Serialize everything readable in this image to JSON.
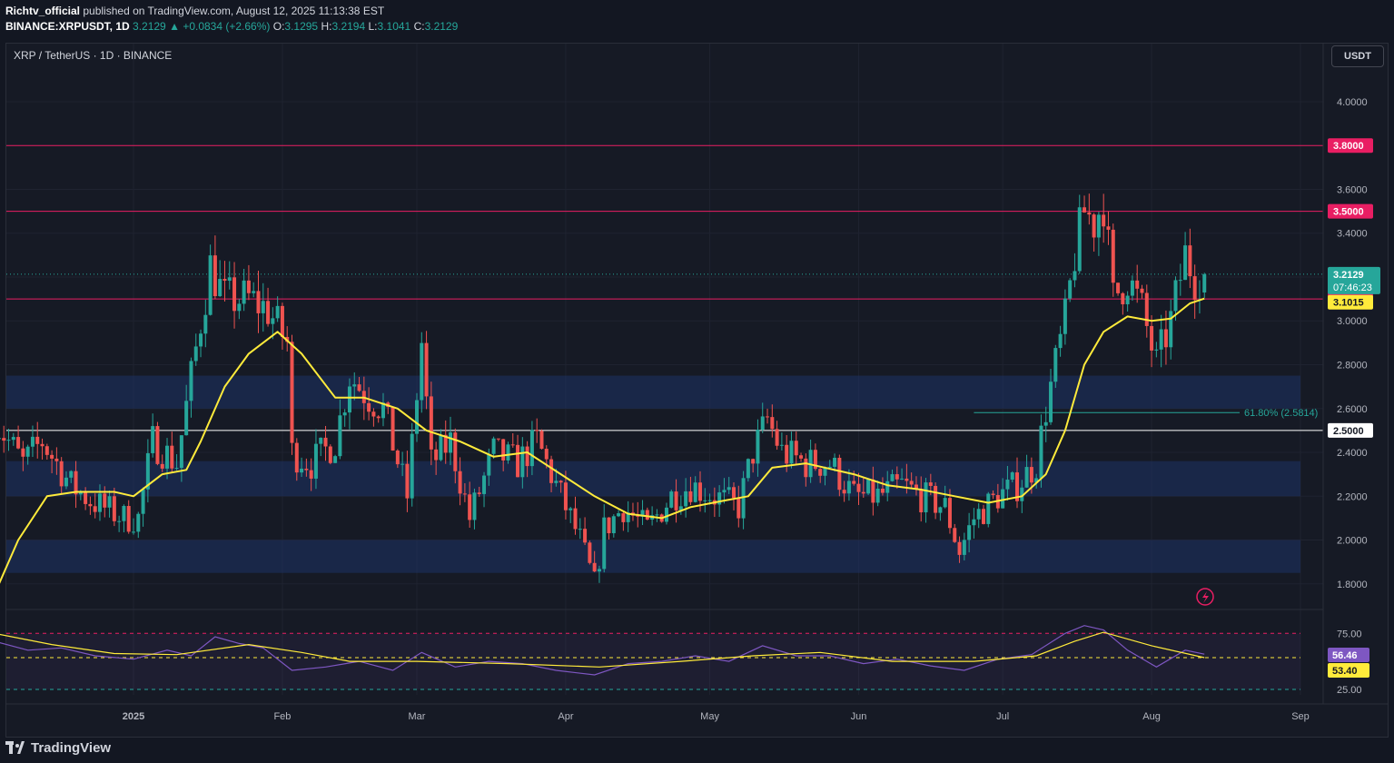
{
  "header": {
    "author": "Richtv_official",
    "published_text": " published on TradingView.com, August 12, 2025 11:13:38 EST",
    "symbol": "BINANCE:XRPUSDT, 1D",
    "last": "3.2129",
    "change": "+0.0834 (+2.66%)",
    "open_label": "O:",
    "open": "3.1295",
    "high_label": "H:",
    "high": "3.2194",
    "low_label": "L:",
    "low": "3.1041",
    "close_label": "C:",
    "close": "3.2129"
  },
  "chart_title": "XRP / TetherUS · 1D · BINANCE",
  "currency_button": "USDT",
  "footer_brand": "TradingView",
  "colors": {
    "background": "#161a25",
    "up": "#26a69a",
    "down": "#ef5350",
    "ma": "#ffeb3b",
    "level_line": "#e91e63",
    "zone": "#1e3366",
    "rsi": "#7e57c2",
    "grid": "#1f2330"
  },
  "chart_data": {
    "type": "candlestick",
    "symbol": "XRPUSDT",
    "timeframe": "1D",
    "start_date": "2024-12-03",
    "y_axis": {
      "ticks": [
        1.8,
        2.0,
        2.2,
        2.4,
        2.6,
        2.8,
        3.0,
        3.2,
        3.4,
        3.6,
        4.0
      ],
      "ylim": [
        1.7,
        4.2
      ]
    },
    "x_axis": {
      "labels": [
        "2025",
        "Feb",
        "Mar",
        "Apr",
        "May",
        "Jun",
        "Jul",
        "Aug",
        "Sep"
      ],
      "label_dates": [
        "2025-01-01",
        "2025-02-01",
        "2025-03-01",
        "2025-04-01",
        "2025-05-01",
        "2025-06-01",
        "2025-07-01",
        "2025-08-01",
        "2025-09-01"
      ]
    },
    "close_path": [
      [
        "2024-12-03",
        2.55
      ],
      [
        "2024-12-09",
        2.35
      ],
      [
        "2024-12-13",
        2.45
      ],
      [
        "2024-12-19",
        2.25
      ],
      [
        "2024-12-23",
        2.18
      ],
      [
        "2024-12-30",
        2.1
      ],
      [
        "2025-01-02",
        2.1
      ],
      [
        "2025-01-05",
        2.45
      ],
      [
        "2025-01-10",
        2.35
      ],
      [
        "2025-01-15",
        3.0
      ],
      [
        "2025-01-17",
        3.25
      ],
      [
        "2025-01-20",
        3.1
      ],
      [
        "2025-01-25",
        3.1
      ],
      [
        "2025-01-29",
        3.05
      ],
      [
        "2025-02-02",
        2.9
      ],
      [
        "2025-02-03",
        2.4
      ],
      [
        "2025-02-07",
        2.35
      ],
      [
        "2025-02-12",
        2.45
      ],
      [
        "2025-02-15",
        2.75
      ],
      [
        "2025-02-19",
        2.65
      ],
      [
        "2025-02-22",
        2.6
      ],
      [
        "2025-02-27",
        2.2
      ],
      [
        "2025-03-02",
        2.9
      ],
      [
        "2025-03-04",
        2.35
      ],
      [
        "2025-03-08",
        2.45
      ],
      [
        "2025-03-12",
        2.1
      ],
      [
        "2025-03-17",
        2.4
      ],
      [
        "2025-03-22",
        2.35
      ],
      [
        "2025-03-26",
        2.45
      ],
      [
        "2025-03-31",
        2.2
      ],
      [
        "2025-04-04",
        2.0
      ],
      [
        "2025-04-07",
        1.8
      ],
      [
        "2025-04-09",
        2.05
      ],
      [
        "2025-04-13",
        2.15
      ],
      [
        "2025-04-18",
        2.05
      ],
      [
        "2025-04-23",
        2.2
      ],
      [
        "2025-04-27",
        2.25
      ],
      [
        "2025-05-02",
        2.2
      ],
      [
        "2025-05-07",
        2.15
      ],
      [
        "2025-05-10",
        2.4
      ],
      [
        "2025-05-13",
        2.55
      ],
      [
        "2025-05-16",
        2.4
      ],
      [
        "2025-05-21",
        2.35
      ],
      [
        "2025-05-26",
        2.35
      ],
      [
        "2025-05-31",
        2.2
      ],
      [
        "2025-06-05",
        2.2
      ],
      [
        "2025-06-10",
        2.25
      ],
      [
        "2025-06-14",
        2.2
      ],
      [
        "2025-06-19",
        2.15
      ],
      [
        "2025-06-22",
        1.95
      ],
      [
        "2025-06-25",
        2.1
      ],
      [
        "2025-06-30",
        2.2
      ],
      [
        "2025-07-04",
        2.25
      ],
      [
        "2025-07-08",
        2.35
      ],
      [
        "2025-07-10",
        2.6
      ],
      [
        "2025-07-12",
        2.8
      ],
      [
        "2025-07-14",
        3.0
      ],
      [
        "2025-07-16",
        3.3
      ],
      [
        "2025-07-18",
        3.5
      ],
      [
        "2025-07-20",
        3.45
      ],
      [
        "2025-07-22",
        3.55
      ],
      [
        "2025-07-24",
        3.1
      ],
      [
        "2025-07-27",
        3.2
      ],
      [
        "2025-07-30",
        3.05
      ],
      [
        "2025-08-02",
        2.8
      ],
      [
        "2025-08-05",
        3.0
      ],
      [
        "2025-08-08",
        3.3
      ],
      [
        "2025-08-10",
        3.2
      ],
      [
        "2025-08-12",
        3.2129
      ]
    ],
    "moving_average": [
      [
        "2024-12-03",
        1.75
      ],
      [
        "2024-12-08",
        2.0
      ],
      [
        "2024-12-14",
        2.2
      ],
      [
        "2024-12-20",
        2.22
      ],
      [
        "2024-12-28",
        2.22
      ],
      [
        "2025-01-01",
        2.2
      ],
      [
        "2025-01-07",
        2.3
      ],
      [
        "2025-01-12",
        2.32
      ],
      [
        "2025-01-15",
        2.45
      ],
      [
        "2025-01-20",
        2.7
      ],
      [
        "2025-01-25",
        2.85
      ],
      [
        "2025-01-31",
        2.95
      ],
      [
        "2025-02-05",
        2.85
      ],
      [
        "2025-02-12",
        2.65
      ],
      [
        "2025-02-18",
        2.65
      ],
      [
        "2025-02-25",
        2.6
      ],
      [
        "2025-03-03",
        2.5
      ],
      [
        "2025-03-10",
        2.45
      ],
      [
        "2025-03-17",
        2.38
      ],
      [
        "2025-03-24",
        2.4
      ],
      [
        "2025-03-31",
        2.3
      ],
      [
        "2025-04-07",
        2.2
      ],
      [
        "2025-04-14",
        2.12
      ],
      [
        "2025-04-21",
        2.1
      ],
      [
        "2025-04-27",
        2.15
      ],
      [
        "2025-05-04",
        2.18
      ],
      [
        "2025-05-09",
        2.2
      ],
      [
        "2025-05-14",
        2.33
      ],
      [
        "2025-05-21",
        2.35
      ],
      [
        "2025-05-31",
        2.3
      ],
      [
        "2025-06-07",
        2.25
      ],
      [
        "2025-06-14",
        2.23
      ],
      [
        "2025-06-21",
        2.2
      ],
      [
        "2025-06-28",
        2.17
      ],
      [
        "2025-07-05",
        2.2
      ],
      [
        "2025-07-10",
        2.3
      ],
      [
        "2025-07-14",
        2.5
      ],
      [
        "2025-07-18",
        2.8
      ],
      [
        "2025-07-22",
        2.95
      ],
      [
        "2025-07-27",
        3.02
      ],
      [
        "2025-08-01",
        3.0
      ],
      [
        "2025-08-05",
        3.01
      ],
      [
        "2025-08-09",
        3.08
      ],
      [
        "2025-08-12",
        3.1015
      ]
    ],
    "horizontal_levels": [
      {
        "value": 3.8,
        "color": "#e91e63",
        "label": "3.8000"
      },
      {
        "value": 3.5,
        "color": "#e91e63",
        "label": "3.5000"
      },
      {
        "value": 3.1,
        "color": "#e91e63",
        "label": "3.1000"
      },
      {
        "value": 2.5,
        "color": "#ffffff",
        "label": "2.5000"
      }
    ],
    "zones": [
      [
        2.6,
        2.75
      ],
      [
        2.2,
        2.36
      ],
      [
        1.85,
        2.0
      ]
    ],
    "fib_level": {
      "value": 2.5814,
      "label": "61.80% (2.5814)",
      "from": "2025-06-25",
      "to": "2025-09-01"
    },
    "last_price": {
      "value": 3.2129,
      "label": "3.2129",
      "countdown": "07:46:23"
    },
    "ma_last": {
      "value": 3.1015,
      "label": "3.1015"
    },
    "rsi": {
      "levels": [
        75,
        53.4,
        25
      ],
      "level_labels": [
        "75.00",
        "25.00"
      ],
      "rsi_label": "56.46",
      "signal_label": "53.40",
      "rsi_path": [
        [
          "2024-12-03",
          68
        ],
        [
          "2024-12-10",
          60
        ],
        [
          "2024-12-17",
          62
        ],
        [
          "2024-12-24",
          55
        ],
        [
          "2025-01-01",
          52
        ],
        [
          "2025-01-08",
          60
        ],
        [
          "2025-01-13",
          55
        ],
        [
          "2025-01-18",
          72
        ],
        [
          "2025-01-23",
          66
        ],
        [
          "2025-01-28",
          62
        ],
        [
          "2025-02-03",
          42
        ],
        [
          "2025-02-10",
          45
        ],
        [
          "2025-02-17",
          50
        ],
        [
          "2025-02-24",
          42
        ],
        [
          "2025-03-02",
          58
        ],
        [
          "2025-03-09",
          45
        ],
        [
          "2025-03-16",
          50
        ],
        [
          "2025-03-23",
          48
        ],
        [
          "2025-03-30",
          42
        ],
        [
          "2025-04-07",
          38
        ],
        [
          "2025-04-14",
          48
        ],
        [
          "2025-04-21",
          50
        ],
        [
          "2025-04-28",
          55
        ],
        [
          "2025-05-05",
          50
        ],
        [
          "2025-05-12",
          64
        ],
        [
          "2025-05-19",
          55
        ],
        [
          "2025-05-26",
          55
        ],
        [
          "2025-06-02",
          48
        ],
        [
          "2025-06-09",
          52
        ],
        [
          "2025-06-16",
          46
        ],
        [
          "2025-06-23",
          42
        ],
        [
          "2025-06-30",
          52
        ],
        [
          "2025-07-07",
          56
        ],
        [
          "2025-07-14",
          75
        ],
        [
          "2025-07-18",
          82
        ],
        [
          "2025-07-22",
          78
        ],
        [
          "2025-07-27",
          60
        ],
        [
          "2025-08-02",
          45
        ],
        [
          "2025-08-08",
          60
        ],
        [
          "2025-08-12",
          56.46
        ]
      ],
      "signal_path": [
        [
          "2024-12-03",
          75
        ],
        [
          "2024-12-15",
          65
        ],
        [
          "2024-12-28",
          57
        ],
        [
          "2025-01-10",
          56
        ],
        [
          "2025-01-25",
          65
        ],
        [
          "2025-02-05",
          58
        ],
        [
          "2025-02-15",
          50
        ],
        [
          "2025-03-01",
          50
        ],
        [
          "2025-03-20",
          48
        ],
        [
          "2025-04-08",
          45
        ],
        [
          "2025-04-25",
          50
        ],
        [
          "2025-05-10",
          55
        ],
        [
          "2025-05-24",
          58
        ],
        [
          "2025-06-08",
          50
        ],
        [
          "2025-06-25",
          50
        ],
        [
          "2025-07-08",
          55
        ],
        [
          "2025-07-16",
          68
        ],
        [
          "2025-07-22",
          76
        ],
        [
          "2025-08-01",
          64
        ],
        [
          "2025-08-12",
          53.4
        ]
      ]
    }
  }
}
